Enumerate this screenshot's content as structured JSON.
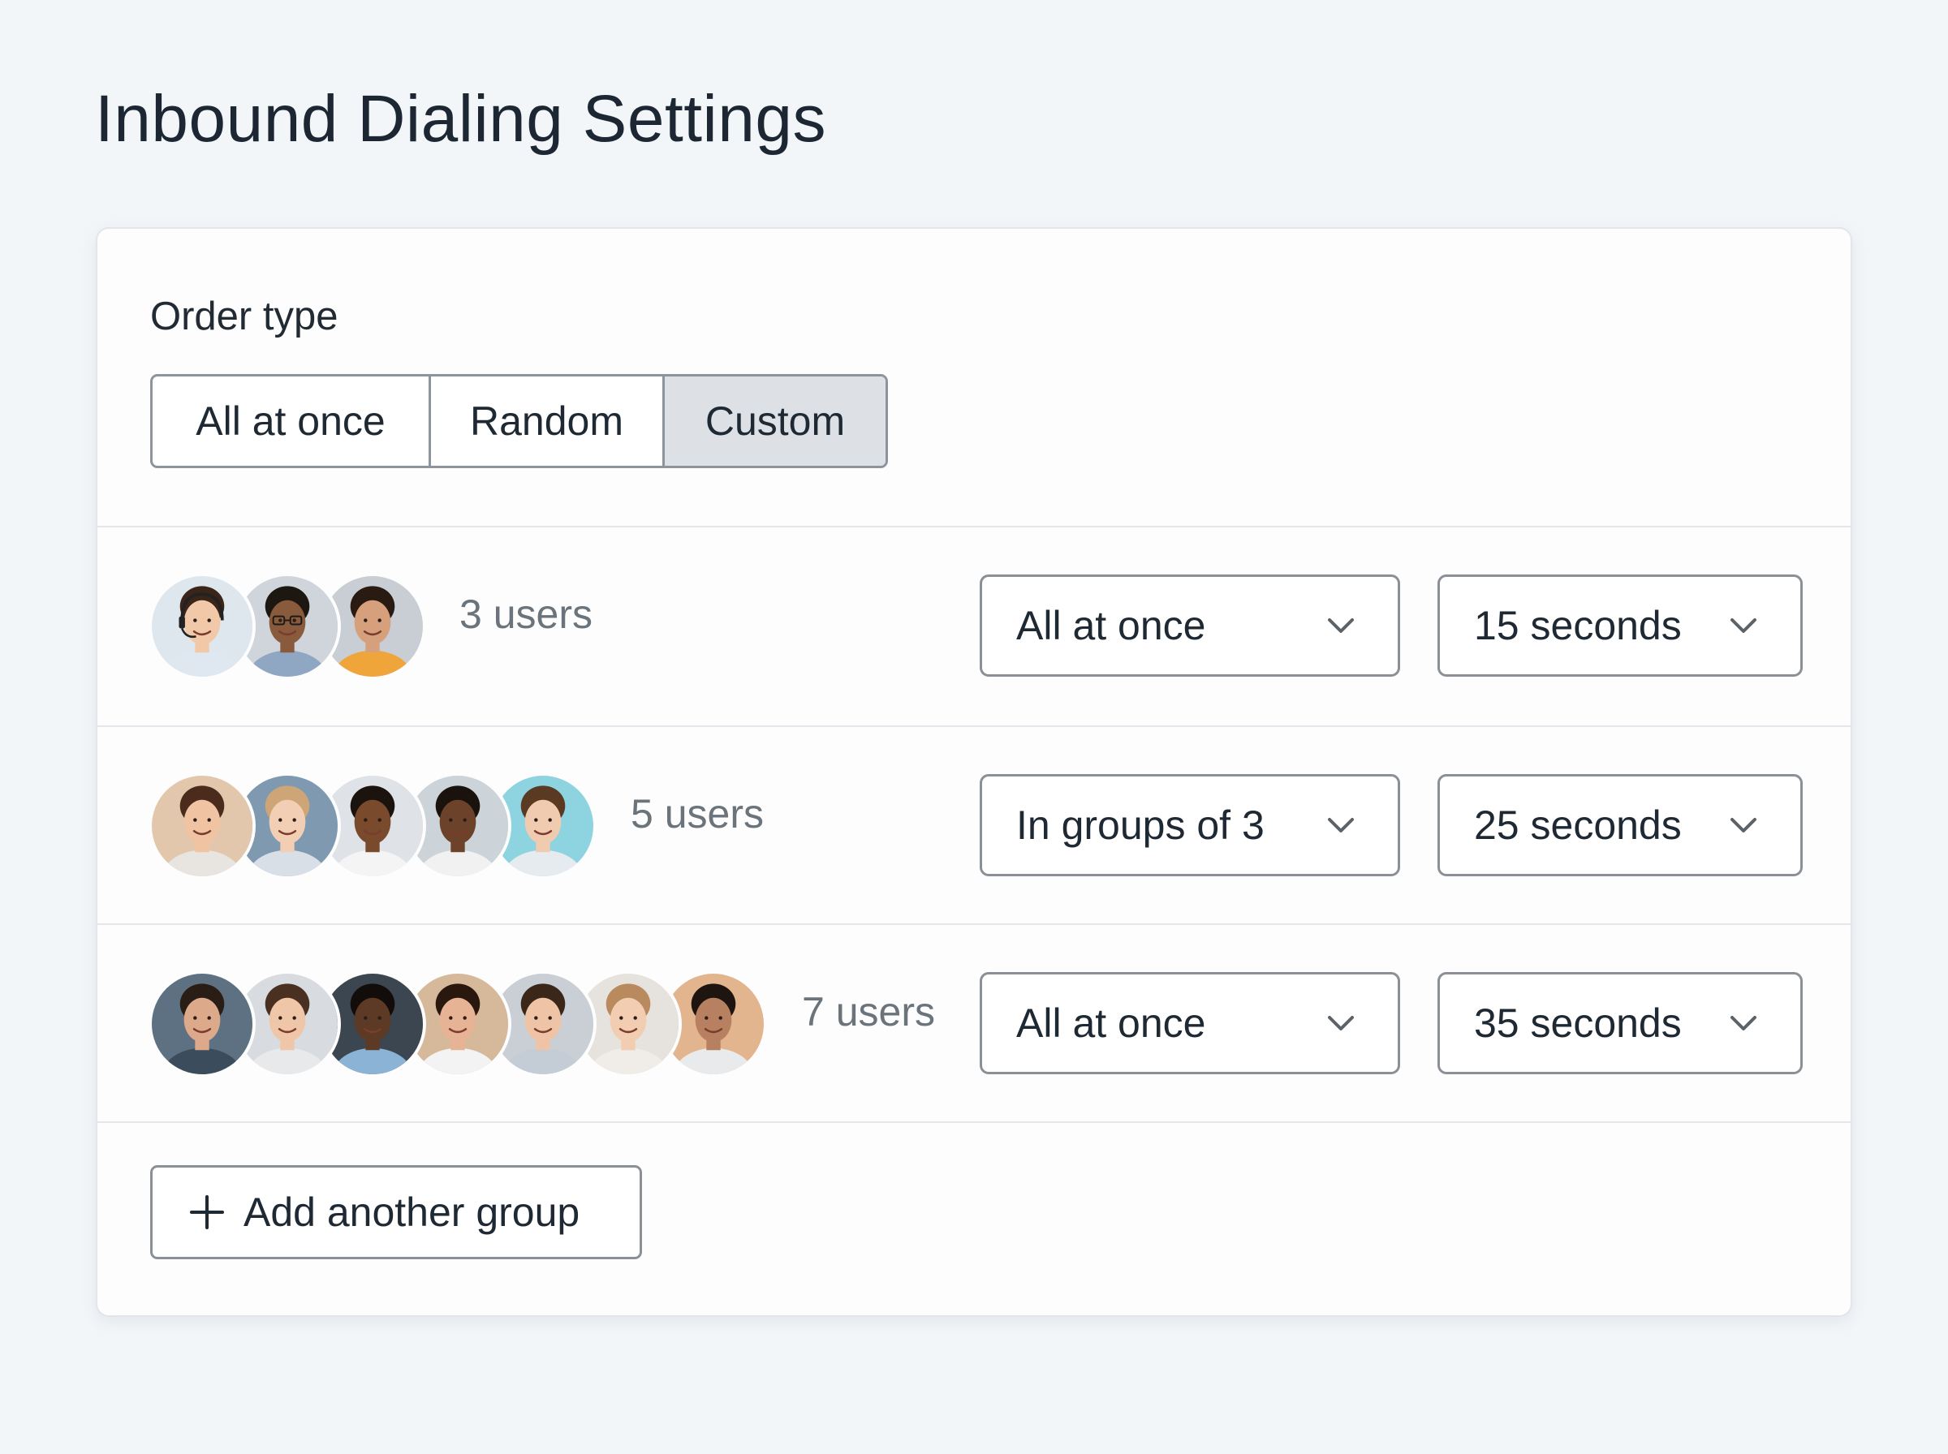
{
  "page": {
    "title": "Inbound Dialing Settings"
  },
  "order": {
    "label": "Order type",
    "options": [
      "All at once",
      "Random",
      "Custom"
    ],
    "selected": "Custom"
  },
  "groups": [
    {
      "user_count": "3 users",
      "mode": "All at once",
      "timeout": "15 seconds",
      "avatars": [
        {
          "bg": "#dfe7ee",
          "skin": "#f1c8a8",
          "hair": "#3a2518",
          "shirt": "#dfe8f0",
          "headset": true
        },
        {
          "bg": "#cfd5db",
          "skin": "#8a5a3c",
          "hair": "#1d1712",
          "shirt": "#8fa7c2",
          "glasses": true
        },
        {
          "bg": "#c9ced4",
          "skin": "#d7a07c",
          "hair": "#2a1b12",
          "shirt": "#f0a53a"
        }
      ]
    },
    {
      "user_count": "5 users",
      "mode": "In groups of 3",
      "timeout": "25 seconds",
      "avatars": [
        {
          "bg": "#e2c7ad",
          "skin": "#f0c3a3",
          "hair": "#4b2c1c",
          "shirt": "#e8e4df"
        },
        {
          "bg": "#7f99b0",
          "skin": "#f2cfb4",
          "hair": "#cda577",
          "shirt": "#d8dfe6"
        },
        {
          "bg": "#dfe3e7",
          "skin": "#7a4a2c",
          "hair": "#1b130e",
          "shirt": "#f4f4f4"
        },
        {
          "bg": "#ccd3d9",
          "skin": "#6c432a",
          "hair": "#1a120c",
          "shirt": "#f1f1f1"
        },
        {
          "bg": "#8dd3e0",
          "skin": "#f1cbb0",
          "hair": "#5a3a22",
          "shirt": "#e5ebef"
        }
      ]
    },
    {
      "user_count": "7 users",
      "mode": "All at once",
      "timeout": "35 seconds",
      "avatars": [
        {
          "bg": "#5d7182",
          "skin": "#dca98a",
          "hair": "#2a1d15",
          "shirt": "#3b4c5c"
        },
        {
          "bg": "#d8dce0",
          "skin": "#f0c6a8",
          "hair": "#4a3020",
          "shirt": "#e7e9eb"
        },
        {
          "bg": "#3c4650",
          "skin": "#5c3a25",
          "hair": "#120d0a",
          "shirt": "#8bb3d6"
        },
        {
          "bg": "#d6b89a",
          "skin": "#e6b494",
          "hair": "#2a170e",
          "shirt": "#f3f3f3"
        },
        {
          "bg": "#c9cfd5",
          "skin": "#efc4a6",
          "hair": "#3b2719",
          "shirt": "#c4cdd6"
        },
        {
          "bg": "#e6e2dd",
          "skin": "#f2cdb1",
          "hair": "#b98a5d",
          "shirt": "#f0ece8"
        },
        {
          "bg": "#e2b58f",
          "skin": "#b78060",
          "hair": "#1f1510",
          "shirt": "#e8eaec"
        }
      ]
    }
  ],
  "add_button": {
    "label": "Add another group",
    "icon": "plus-icon"
  },
  "icons": {
    "select_arrow": "chevron-down-icon"
  },
  "colors": {
    "selected_segment": "#dde1e6",
    "border": "#8a9096",
    "muted_text": "#6b737b"
  }
}
